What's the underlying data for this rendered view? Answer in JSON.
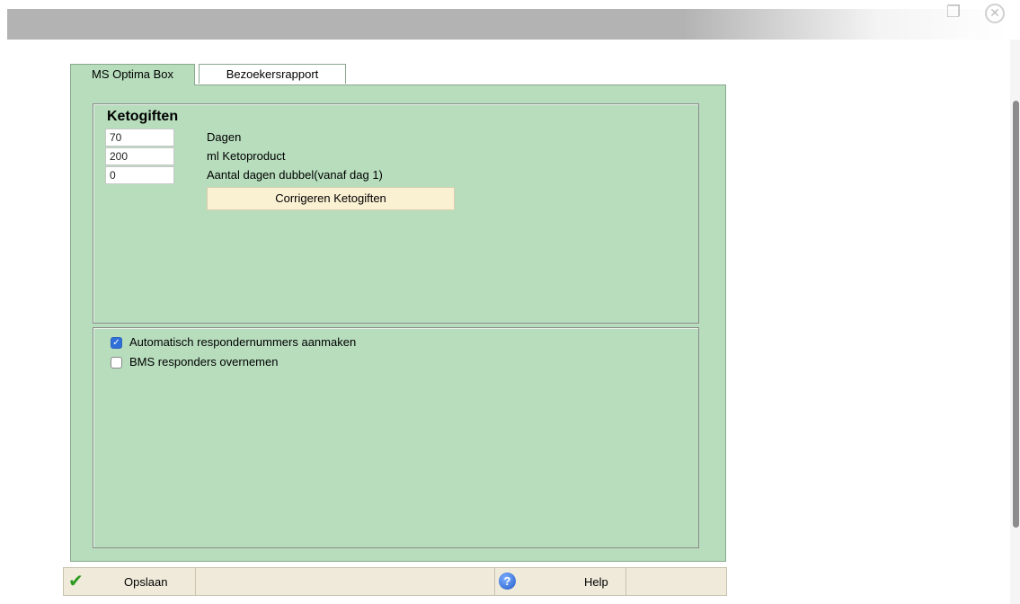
{
  "titlebar": {
    "restore_icon": "restore-window-icon",
    "close_icon": "close-icon"
  },
  "tabs": [
    {
      "label": "MS Optima Box",
      "active": true
    },
    {
      "label": "Bezoekersrapport",
      "active": false
    }
  ],
  "ketogiften": {
    "title": "Ketogiften",
    "fields": [
      {
        "value": "70",
        "label": "Dagen"
      },
      {
        "value": "200",
        "label": "ml Ketoproduct"
      },
      {
        "value": "0",
        "label": "Aantal dagen dubbel(vanaf dag 1)"
      }
    ],
    "correct_button": "Corrigeren Ketogiften"
  },
  "responders": {
    "auto_label": "Automatisch respondernummers aanmaken",
    "auto_checked": true,
    "bms_label": "BMS responders overnemen",
    "bms_checked": false
  },
  "toolbar": {
    "save_label": "Opslaan",
    "help_label": "Help",
    "save_icon_glyph": "✔",
    "help_icon_glyph": "?"
  },
  "colors": {
    "panel": "#b7ddbd",
    "button": "#faf0d2",
    "toolbar": "#efeada",
    "titlebar": "#b3b3b3"
  }
}
